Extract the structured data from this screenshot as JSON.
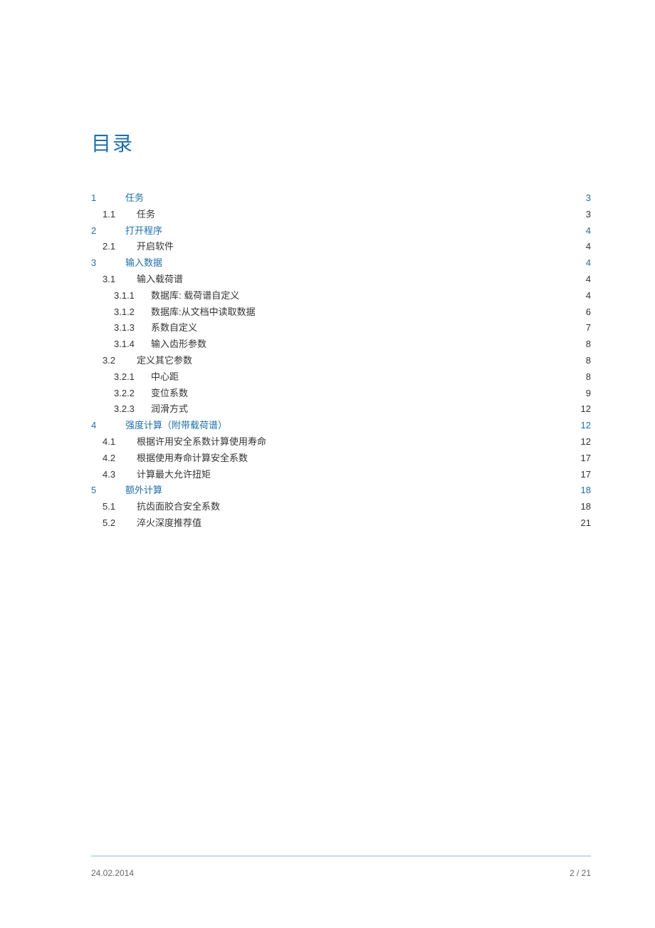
{
  "title": "目录",
  "toc": [
    {
      "level": 1,
      "number": "1",
      "label": "任务",
      "page": "3"
    },
    {
      "level": 2,
      "number": "1.1",
      "label": "任务",
      "page": "3"
    },
    {
      "level": 1,
      "number": "2",
      "label": "打开程序",
      "page": "4"
    },
    {
      "level": 2,
      "number": "2.1",
      "label": "开启软件",
      "page": "4"
    },
    {
      "level": 1,
      "number": "3",
      "label": "输入数据",
      "page": "4"
    },
    {
      "level": 2,
      "number": "3.1",
      "label": "输入载荷谱",
      "page": "4"
    },
    {
      "level": 3,
      "number": "3.1.1",
      "label": "数据库: 载荷谱自定义",
      "page": "4"
    },
    {
      "level": 3,
      "number": "3.1.2",
      "label": "数据库:从文档中读取数据",
      "page": "6"
    },
    {
      "level": 3,
      "number": "3.1.3",
      "label": "系数自定义",
      "page": "7"
    },
    {
      "level": 3,
      "number": "3.1.4",
      "label": "输入齿形参数",
      "page": "8"
    },
    {
      "level": 2,
      "number": "3.2",
      "label": "定义其它参数",
      "page": "8"
    },
    {
      "level": 3,
      "number": "3.2.1",
      "label": "中心距",
      "page": "8"
    },
    {
      "level": 3,
      "number": "3.2.2",
      "label": "变位系数",
      "page": "9"
    },
    {
      "level": 3,
      "number": "3.2.3",
      "label": "润滑方式",
      "page": "12"
    },
    {
      "level": 1,
      "number": "4",
      "label": "强度计算（附带载荷谱）",
      "page": "12"
    },
    {
      "level": 2,
      "number": "4.1",
      "label": "根据许用安全系数计算使用寿命",
      "page": "12"
    },
    {
      "level": 2,
      "number": "4.2",
      "label": "根据使用寿命计算安全系数",
      "page": "17"
    },
    {
      "level": 2,
      "number": "4.3",
      "label": "计算最大允许扭矩",
      "page": "17"
    },
    {
      "level": 1,
      "number": "5",
      "label": "额外计算",
      "page": "18"
    },
    {
      "level": 2,
      "number": "5.1",
      "label": "抗齿面胶合安全系数",
      "page": "18"
    },
    {
      "level": 2,
      "number": "5.2",
      "label": "淬火深度推荐值",
      "page": "21"
    }
  ],
  "footer": {
    "date": "24.02.2014",
    "pagination": "2 / 21"
  }
}
